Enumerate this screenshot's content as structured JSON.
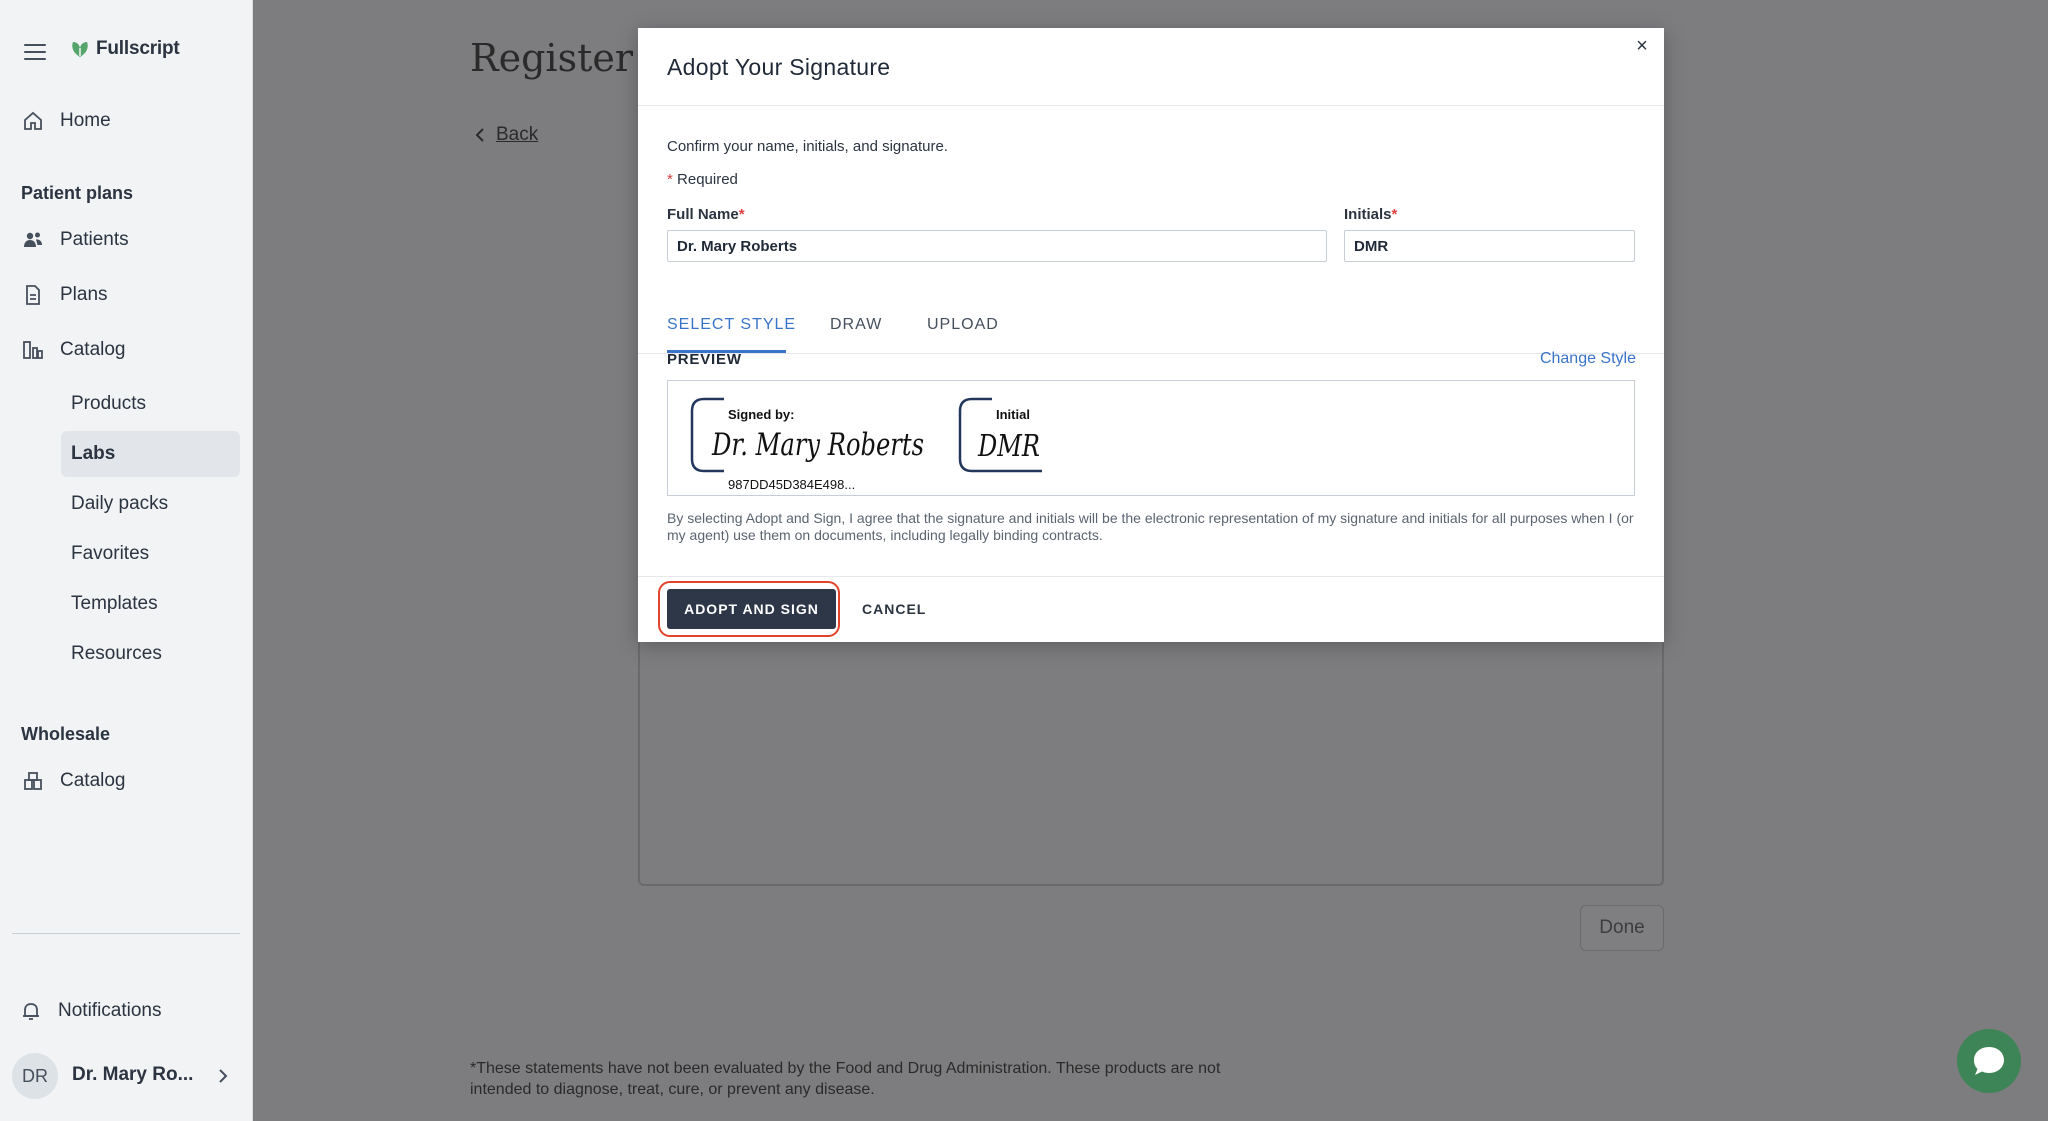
{
  "app": {
    "logo_text": "Fullscript",
    "brand_color": "#3d8456"
  },
  "sidebar": {
    "home_label": "Home",
    "patient_plans_title": "Patient plans",
    "patients_label": "Patients",
    "plans_label": "Plans",
    "catalog_label": "Catalog",
    "sub_items": [
      "Products",
      "Labs",
      "Daily packs",
      "Favorites",
      "Templates",
      "Resources"
    ],
    "active_sub_item": "Labs",
    "wholesale_title": "Wholesale",
    "wholesale_catalog_label": "Catalog",
    "notifications_label": "Notifications",
    "user_initials": "DR",
    "user_name": "Dr. Mary Ro..."
  },
  "page": {
    "title": "Register :",
    "back_label": "Back",
    "done_label": "Done",
    "disclaimer": "*These statements have not been evaluated by the Food and Drug Administration. These products are not intended to diagnose, treat, cure, or prevent any disease."
  },
  "modal": {
    "title": "Adopt Your Signature",
    "close_symbol": "×",
    "confirm_text": "Confirm your name, initials, and signature.",
    "required_star": "*",
    "required_text": "Required",
    "full_name_label": "Full Name",
    "full_name_value": "Dr. Mary Roberts",
    "initials_label": "Initials",
    "initials_value": "DMR",
    "tabs": [
      "SELECT STYLE",
      "DRAW",
      "UPLOAD"
    ],
    "active_tab": "SELECT STYLE",
    "preview_label": "PREVIEW",
    "change_style_label": "Change Style",
    "signature_caption": "Signed by:",
    "signature_script": "Dr. Mary Roberts",
    "signature_hash": "987DD45D384E498...",
    "initial_caption": "Initial",
    "initial_script": "DMR",
    "legal_text": "By selecting Adopt and Sign, I agree that the signature and initials will be the electronic representation of my signature and initials for all purposes when I (or my agent) use them on documents, including legally binding contracts.",
    "adopt_label": "ADOPT AND SIGN",
    "cancel_label": "CANCEL",
    "accent_color": "#3a74c9",
    "highlight_color": "#e2442b"
  }
}
